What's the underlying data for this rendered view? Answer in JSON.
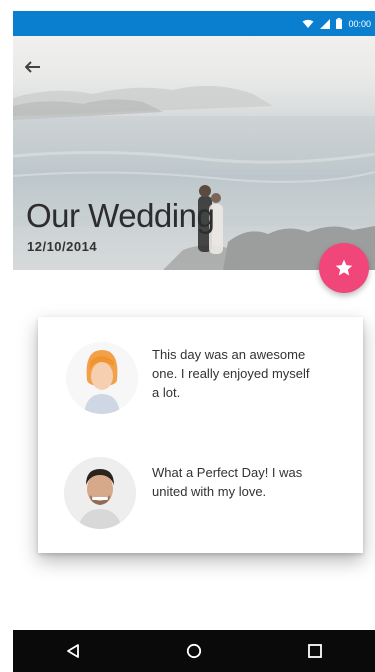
{
  "status_bar": {
    "time": "00:00",
    "icons": [
      "wifi-icon",
      "signal-icon",
      "battery-icon"
    ]
  },
  "hero": {
    "title": "Our Wedding",
    "date": "12/10/2014",
    "back_icon": "back-arrow-icon",
    "fab_icon": "star-icon"
  },
  "comments": [
    {
      "avatar": "woman-avatar",
      "text": "This day was an awesome one. I really enjoyed myself a lot."
    },
    {
      "avatar": "man-avatar",
      "text": "What a Perfect Day! I was united with my love."
    }
  ],
  "nav_bar": {
    "buttons": [
      "back-triangle-icon",
      "home-circle-icon",
      "recents-square-icon"
    ]
  },
  "colors": {
    "status_bar": "#0a7fcf",
    "fab": "#f0467a",
    "nav_bar": "#0a0a0a"
  }
}
